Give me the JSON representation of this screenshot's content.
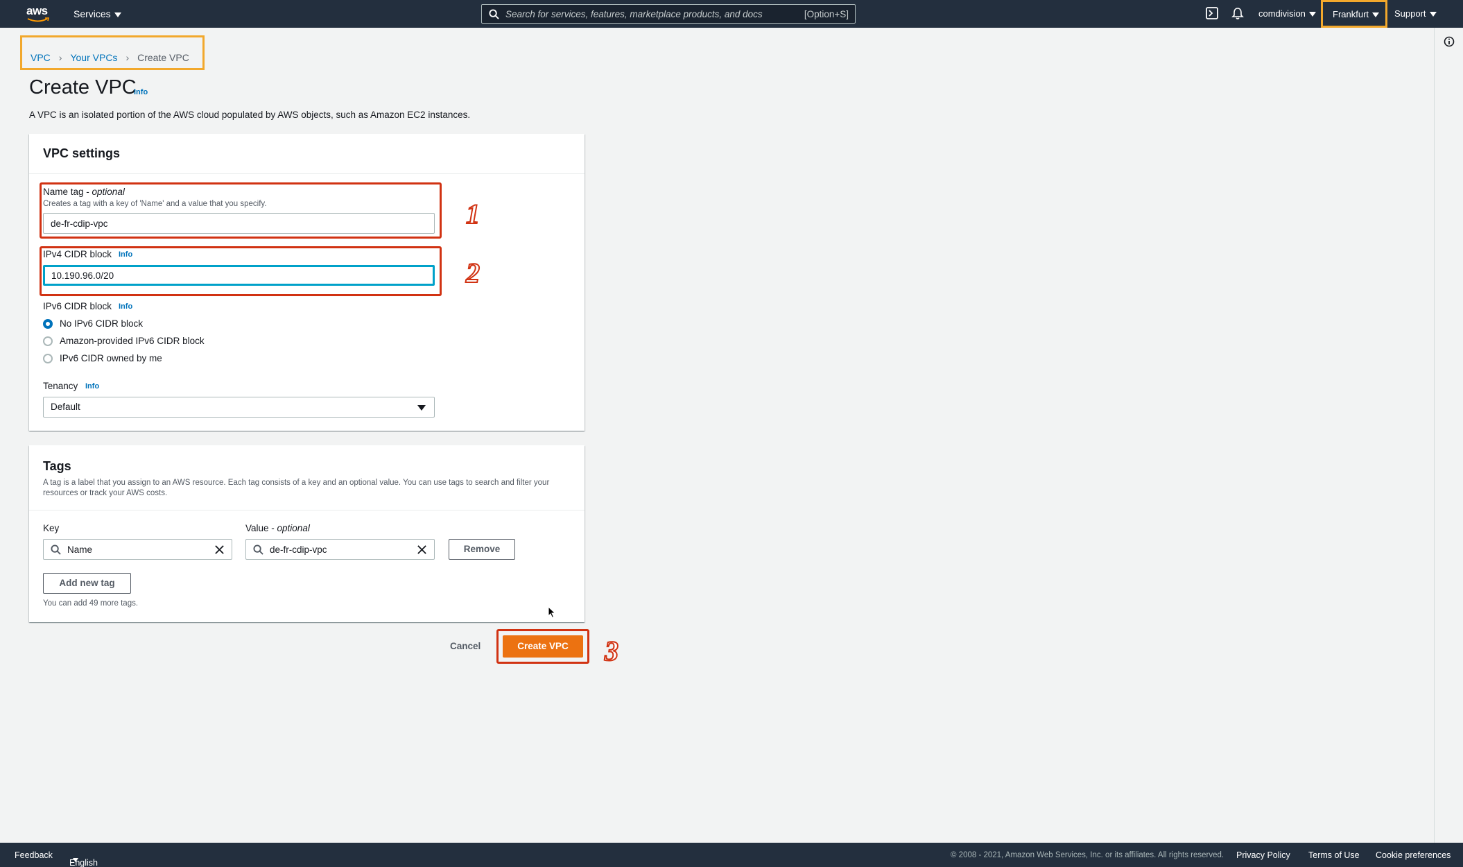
{
  "topnav": {
    "logo_text": "aws",
    "services_label": "Services",
    "search_placeholder": "Search for services, features, marketplace products, and docs",
    "search_shortcut": "[Option+S]",
    "user_label": "comdivision",
    "region_label": "Frankfurt",
    "support_label": "Support"
  },
  "breadcrumb": {
    "items": [
      "VPC",
      "Your VPCs"
    ],
    "current": "Create VPC"
  },
  "page": {
    "title": "Create VPC",
    "info_label": "Info",
    "description": "A VPC is an isolated portion of the AWS cloud populated by AWS objects, such as Amazon EC2 instances."
  },
  "vpc_settings": {
    "title": "VPC settings",
    "name_tag_label": "Name tag - ",
    "name_tag_optional": "optional",
    "name_tag_description": "Creates a tag with a key of 'Name' and a value that you specify.",
    "name_tag_value": "de-fr-cdip-vpc",
    "ipv4_label": "IPv4 CIDR block",
    "ipv4_info": "Info",
    "ipv4_value": "10.190.96.0/20",
    "ipv6_label": "IPv6 CIDR block",
    "ipv6_info": "Info",
    "ipv6_options": [
      "No IPv6 CIDR block",
      "Amazon-provided IPv6 CIDR block",
      "IPv6 CIDR owned by me"
    ],
    "ipv6_selected_index": 0,
    "tenancy_label": "Tenancy",
    "tenancy_info": "Info",
    "tenancy_value": "Default"
  },
  "tags": {
    "title": "Tags",
    "description": "A tag is a label that you assign to an AWS resource. Each tag consists of a key and an optional value. You can use tags to search and filter your resources or track your AWS costs.",
    "key_label": "Key",
    "value_label": "Value - ",
    "value_optional": "optional",
    "key_value": "Name",
    "value_value": "de-fr-cdip-vpc",
    "remove_label": "Remove",
    "add_label": "Add new tag",
    "hint": "You can add 49 more tags."
  },
  "actions": {
    "cancel_label": "Cancel",
    "create_label": "Create VPC"
  },
  "annotations": {
    "step1": "1",
    "step2": "2",
    "step3": "3"
  },
  "footer": {
    "feedback_label": "Feedback",
    "language_label": "English (US)",
    "copyright": "© 2008 - 2021, Amazon Web Services, Inc. or its affiliates. All rights reserved.",
    "privacy_label": "Privacy Policy",
    "terms_label": "Terms of Use",
    "cookie_label": "Cookie preferences"
  },
  "colors": {
    "nav_bg": "#232f3e",
    "primary_button": "#ec7211",
    "link": "#0073bb",
    "highlight_orange": "#f2a82c",
    "highlight_red": "#d13212",
    "focus": "#00a1c9"
  }
}
